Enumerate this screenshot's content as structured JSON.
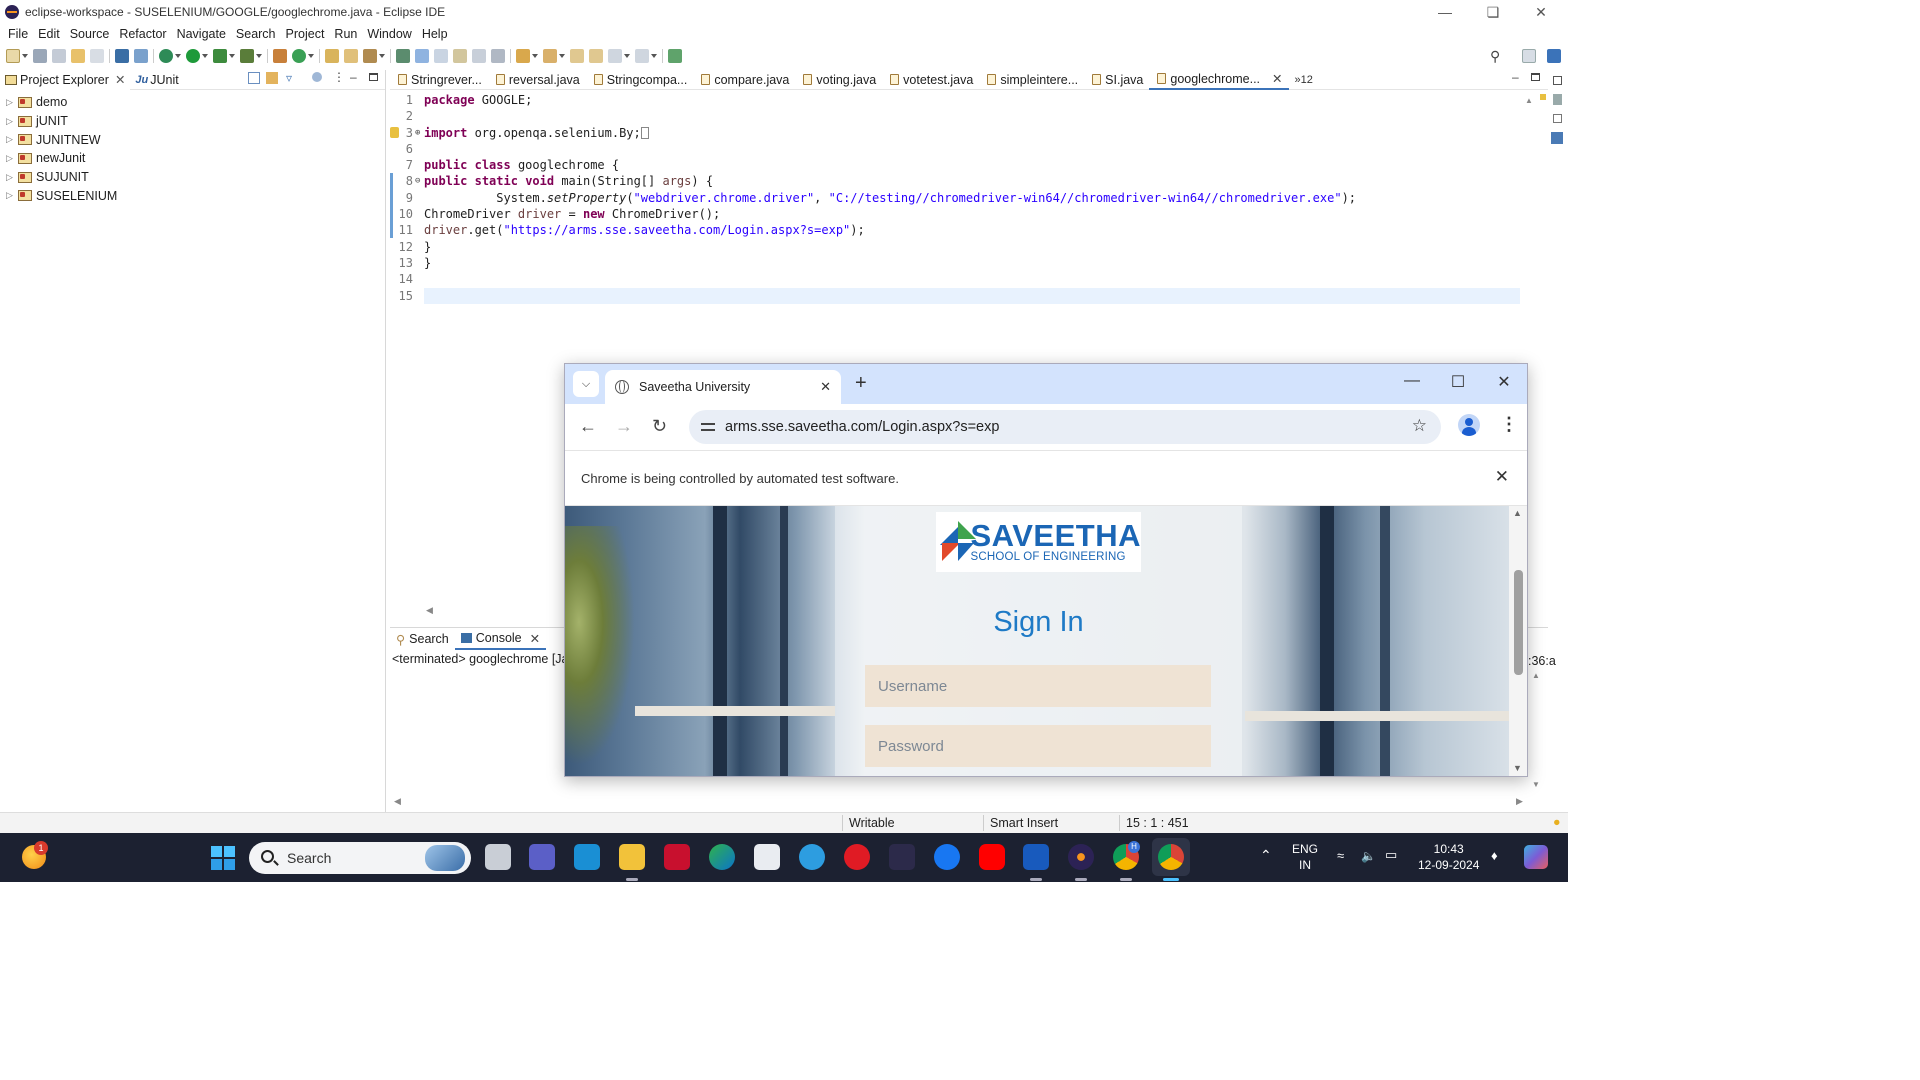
{
  "window": {
    "title": "eclipse-workspace - SUSELENIUM/GOOGLE/googlechrome.java - Eclipse IDE"
  },
  "menu": [
    "File",
    "Edit",
    "Source",
    "Refactor",
    "Navigate",
    "Search",
    "Project",
    "Run",
    "Window",
    "Help"
  ],
  "explorer": {
    "tabs": [
      {
        "label": "Project Explorer",
        "icon": "project-explorer-icon"
      },
      {
        "label": "JUnit",
        "icon": "junit-icon",
        "prefix": "Ju"
      }
    ],
    "projects": [
      "demo",
      "jUNIT",
      "JUNITNEW",
      "newJunit",
      "SUJUNIT",
      "SUSELENIUM"
    ]
  },
  "editor": {
    "tabs": [
      "Stringrever...",
      "reversal.java",
      "Stringcompa...",
      "compare.java",
      "voting.java",
      "votetest.java",
      "simpleintere...",
      "SI.java",
      "googlechrome..."
    ],
    "active_tab": "googlechrome...",
    "overflow_count": "»12",
    "line_numbers": [
      "1",
      "2",
      "3",
      "6",
      "7",
      "8",
      "9",
      "10",
      "11",
      "12",
      "13",
      "14",
      "15"
    ],
    "lines": {
      "l1_kw": "package",
      "l1_rest": " GOOGLE;",
      "l3_kw": "import",
      "l3_rest": " org.openqa.selenium.By;",
      "l7_kw1": "public",
      "l7_kw2": "class",
      "l7_rest": " googlechrome {",
      "l8_kw1": "public",
      "l8_kw2": "static",
      "l8_kw3": "void",
      "l8_rest": " main(String[] ",
      "l8_arg": "args",
      "l8_end": ") {",
      "l9_pre": "          System.",
      "l9_meth": "setProperty",
      "l9_s1": "\"webdriver.chrome.driver\"",
      "l9_mid": ", ",
      "l9_s2": "\"C://testing//chromedriver-win64//chromedriver-win64//chromedriver.exe\"",
      "l9_end": ");",
      "l10_pre": "ChromeDriver ",
      "l10_var": "driver",
      "l10_mid": " = ",
      "l10_kw": "new",
      "l10_end": " ChromeDriver();",
      "l11_var": "driver",
      "l11_mid": ".get(",
      "l11_s": "\"https://arms.sse.saveetha.com/Login.aspx?s=exp\"",
      "l11_end": ");",
      "l12": "}",
      "l13": "}"
    }
  },
  "console": {
    "tabs": [
      "Search",
      "Console"
    ],
    "output": "<terminated> googlechrome [Ja",
    "right_fragment": ":36:a"
  },
  "status": {
    "writable": "Writable",
    "insert_mode": "Smart Insert",
    "position": "15 : 1 : 451"
  },
  "chrome": {
    "tab_title": "Saveetha University",
    "url": "arms.sse.saveetha.com/Login.aspx?s=exp",
    "automation_notice": "Chrome is being controlled by automated test software.",
    "logo_line1": "SAVEETHA",
    "logo_line2": "SCHOOL OF ENGINEERING",
    "heading": "Sign In",
    "username_placeholder": "Username",
    "password_placeholder": "Password"
  },
  "taskbar": {
    "search_placeholder": "Search",
    "notification_badge": "1",
    "language_line1": "ENG",
    "language_line2": "IN",
    "time": "10:43",
    "date": "12-09-2024",
    "chrome_profile_badge": "H"
  },
  "colors": {
    "eclipse_keyword": "#7f0055",
    "eclipse_string": "#2a00ff",
    "chrome_tabstrip": "#d3e3fd",
    "saveetha_blue": "#1b66b5",
    "taskbar_bg": "#1c2131"
  }
}
